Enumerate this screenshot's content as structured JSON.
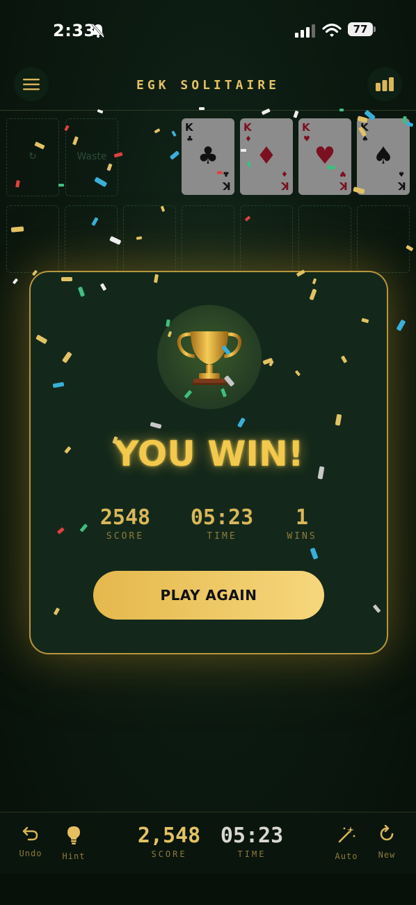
{
  "status": {
    "time": "2:33",
    "battery": "77"
  },
  "header": {
    "title": "EGK SOLITAIRE"
  },
  "board": {
    "waste_label": "Waste",
    "foundations": [
      {
        "rank": "K",
        "suit": "♣",
        "color": "black"
      },
      {
        "rank": "K",
        "suit": "♦",
        "color": "red"
      },
      {
        "rank": "K",
        "suit": "♥",
        "color": "red"
      },
      {
        "rank": "K",
        "suit": "♠",
        "color": "black"
      }
    ]
  },
  "win": {
    "title": "YOU WIN!",
    "score_value": "2548",
    "score_label": "SCORE",
    "time_value": "05:23",
    "time_label": "TIME",
    "wins_value": "1",
    "wins_label": "WINS",
    "play_again": "PLAY AGAIN"
  },
  "bottom_bar": {
    "undo": "Undo",
    "hint": "Hint",
    "score_value": "2,548",
    "score_label": "SCORE",
    "time_value": "05:23",
    "time_label": "TIME",
    "auto": "Auto",
    "new": "New"
  },
  "colors": {
    "gold": "#e2c264",
    "background": "#0c1a11",
    "panel": "#13281b"
  }
}
